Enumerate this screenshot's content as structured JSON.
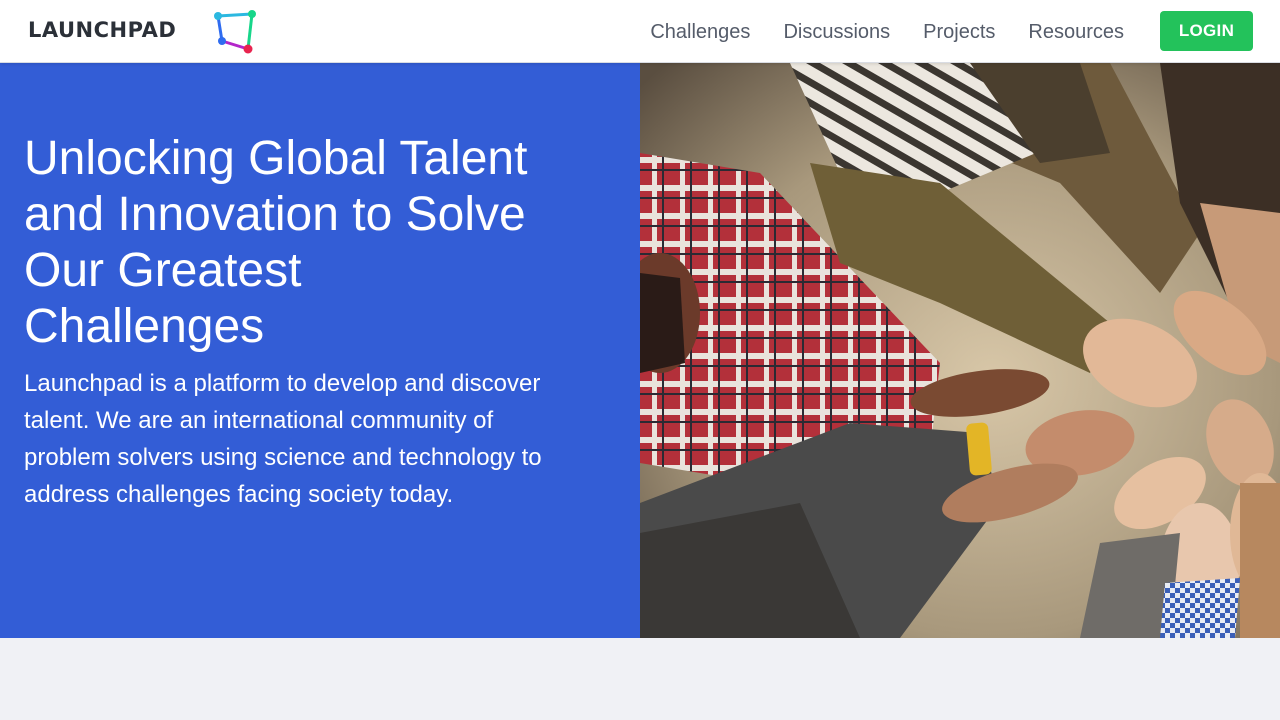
{
  "brand": {
    "name": "LAUNCHPAD",
    "logo_colors": [
      "#17d68a",
      "#2bb8e0",
      "#2f6cf0",
      "#e8244f",
      "#b326c9"
    ]
  },
  "nav": {
    "items": [
      {
        "label": "Challenges"
      },
      {
        "label": "Discussions"
      },
      {
        "label": "Projects"
      },
      {
        "label": "Resources"
      }
    ],
    "login_label": "LOGIN"
  },
  "hero": {
    "title": "Unlocking Global Talent and Innovation to Solve Our Greatest Challenges",
    "description": "Launchpad is a platform to develop and discover talent. We are an international community of problem solvers using science and technology to address challenges facing society today.",
    "image_icon": "team-hands-photo"
  },
  "colors": {
    "hero_blue": "#335dd6",
    "login_green": "#23c25b",
    "page_bg": "#f0f1f5"
  }
}
